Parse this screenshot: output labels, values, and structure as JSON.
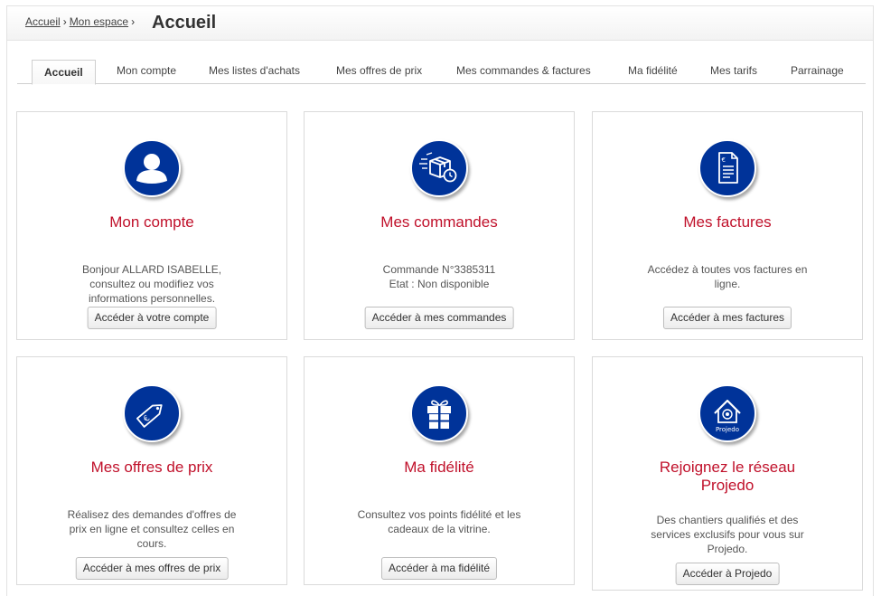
{
  "breadcrumb": {
    "home": "Accueil",
    "space": "Mon espace",
    "separator": "›"
  },
  "page_title": "Accueil",
  "tabs": [
    {
      "label": "Accueil",
      "active": true
    },
    {
      "label": "Mon compte"
    },
    {
      "label": "Mes listes d'achats"
    },
    {
      "label": "Mes offres de prix"
    },
    {
      "label": "Mes commandes & factures"
    },
    {
      "label": "Ma fidélité"
    },
    {
      "label": "Mes tarifs"
    },
    {
      "label": "Parrainage"
    }
  ],
  "cards": {
    "account": {
      "icon": "user-icon",
      "title": "Mon compte",
      "text_lines": [
        "Bonjour ALLARD ISABELLE,",
        "consultez ou modifiez vos",
        "informations personnelles."
      ],
      "button": "Accéder à votre compte"
    },
    "orders": {
      "icon": "delivery-box-icon",
      "title": "Mes commandes",
      "text_lines": [
        "Commande N°3385311",
        "Etat : Non disponible"
      ],
      "button": "Accéder à mes commandes"
    },
    "invoices": {
      "icon": "invoice-icon",
      "title": "Mes factures",
      "text_lines": [
        "Accédez à toutes vos factures en",
        "ligne."
      ],
      "button": "Accéder à mes factures"
    },
    "offers": {
      "icon": "price-tag-icon",
      "title": "Mes offres de prix",
      "text_lines": [
        "Réalisez des demandes d'offres de",
        "prix en ligne et consultez celles en",
        "cours."
      ],
      "button": "Accéder à mes offres de prix"
    },
    "loyalty": {
      "icon": "gift-icon",
      "title": "Ma fidélité",
      "text_lines": [
        "Consultez vos points fidélité et les",
        "cadeaux de la vitrine."
      ],
      "button": "Accéder à ma fidélité"
    },
    "projedo": {
      "icon": "projedo-house-icon",
      "title_lines": [
        "Rejoignez le réseau",
        "Projedo"
      ],
      "icon_label": "Projedo",
      "text_lines": [
        "Des chantiers qualifiés et des",
        "services exclusifs pour vous sur",
        "Projedo."
      ],
      "button": "Accéder à Projedo"
    }
  },
  "colors": {
    "icon_bg": "#003399",
    "title_red": "#c0102a",
    "border": "#dadada"
  }
}
